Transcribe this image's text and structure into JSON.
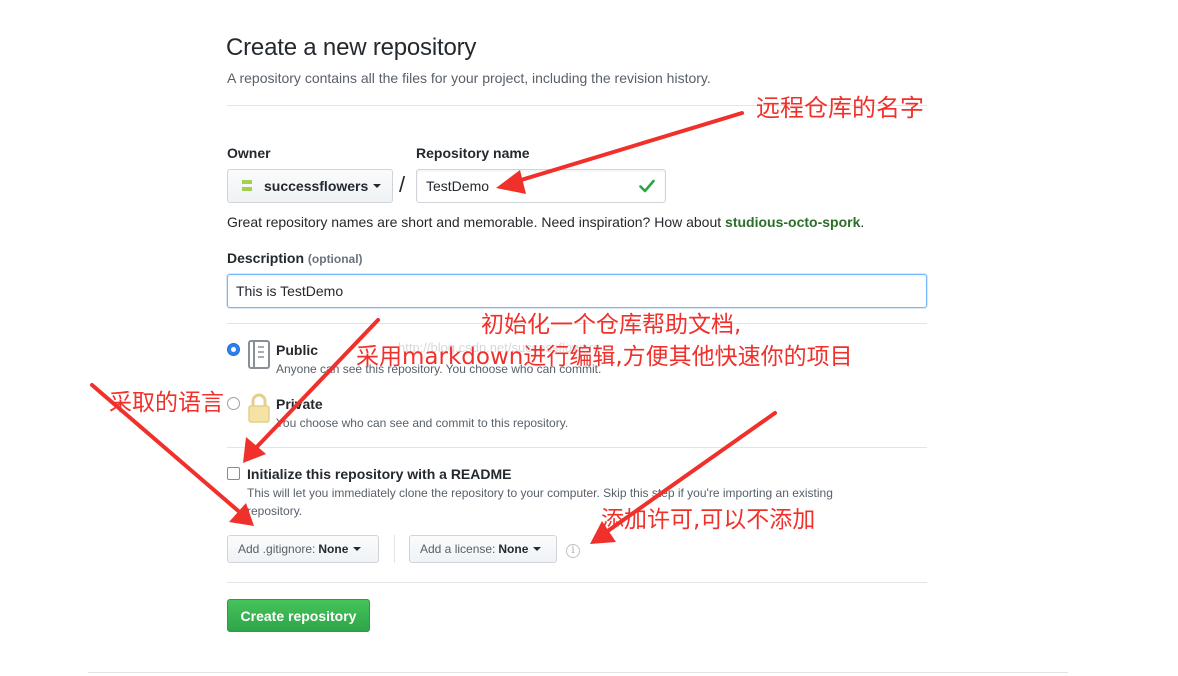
{
  "header": {
    "title": "Create a new repository",
    "subtitle": "A repository contains all the files for your project, including the revision history."
  },
  "owner": {
    "label": "Owner",
    "value": "successflowers"
  },
  "repo": {
    "label": "Repository name",
    "value": "TestDemo",
    "separator": "/"
  },
  "hint": {
    "prefix": "Great repository names are short and memorable. Need inspiration? How about ",
    "suggestion": "studious-octo-spork",
    "suffix": "."
  },
  "description": {
    "label": "Description",
    "optional": "(optional)",
    "value": "This is TestDemo"
  },
  "visibility": {
    "public_title": "Public",
    "public_desc": "Anyone can see this repository. You choose who can commit.",
    "private_title": "Private",
    "private_desc": "You choose who can see and commit to this repository."
  },
  "readme": {
    "title": "Initialize this repository with a README",
    "desc_line1": "This will let you immediately clone the repository to your computer. Skip this step if you're importing an existing",
    "desc_line2": "repository."
  },
  "gitignore": {
    "prefix": "Add .gitignore:",
    "value": "None"
  },
  "license": {
    "prefix": "Add a license:",
    "value": "None"
  },
  "create_button": "Create repository",
  "watermark": "http://blog.csdn.net/successflowers",
  "annotations": {
    "repo_name": "远程仓库的名字",
    "readme_line1": "初始化一个仓库帮助文档,",
    "readme_line2": "采用markdown进行编辑,方便其他快速你的项目",
    "language": "采取的语言",
    "license": "添加许可,可以不添加"
  },
  "colors": {
    "annotation": "#f0302b",
    "primary_button": "#2ea54a",
    "suggestion": "#2c6e2a",
    "radio_selected": "#2f80ed"
  }
}
